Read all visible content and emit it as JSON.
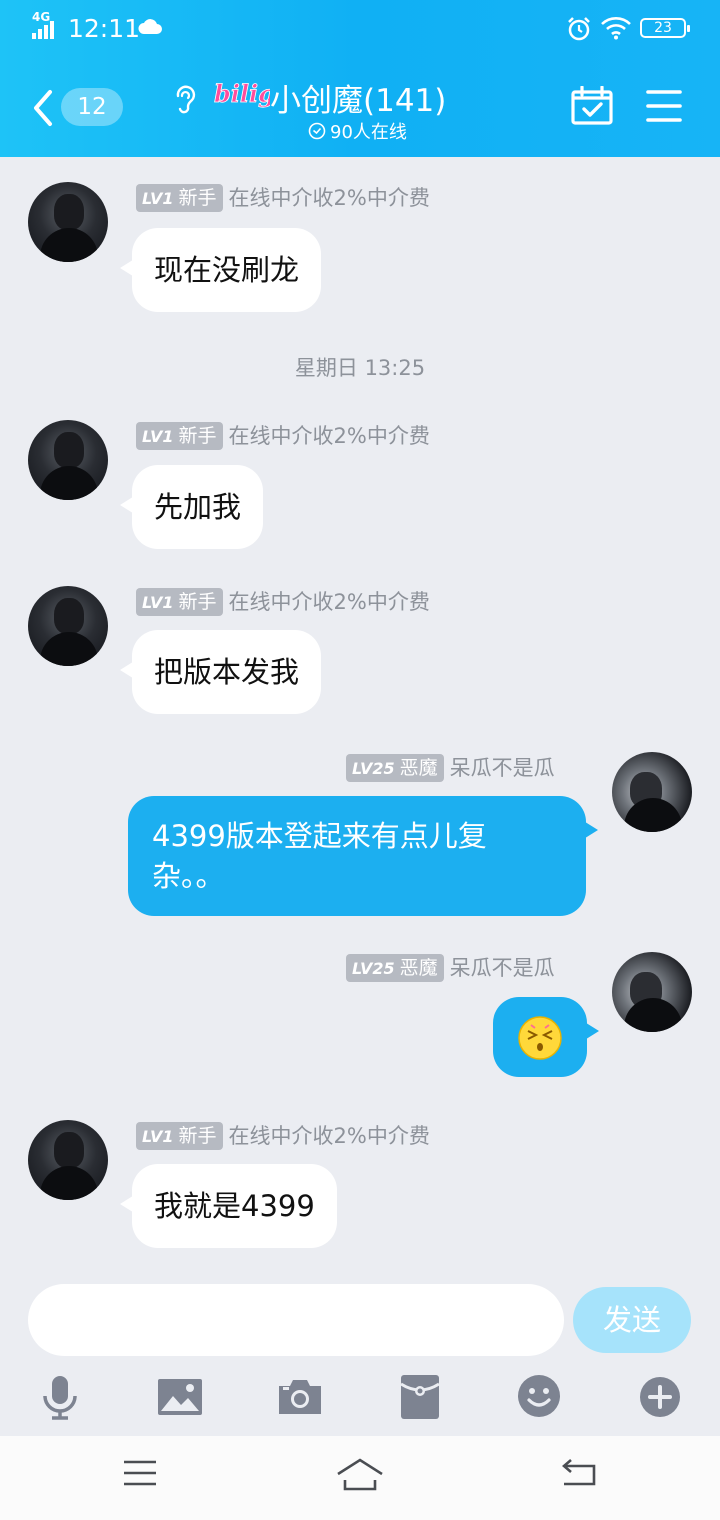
{
  "status_bar": {
    "network": "4G",
    "time": "12:11",
    "battery": "23"
  },
  "header": {
    "unread_count": "12",
    "group_title": "小创魔(141)",
    "online_count": "90人在线",
    "accent_color": "#12b2f5"
  },
  "messages": [
    {
      "side": "left",
      "level": "LV1",
      "rank": "新手",
      "sender": "在线中介收2%中介费",
      "text": "现在没刷龙"
    },
    {
      "side": "left",
      "level": "LV1",
      "rank": "新手",
      "sender": "在线中介收2%中介费",
      "text": "先加我"
    },
    {
      "side": "left",
      "level": "LV1",
      "rank": "新手",
      "sender": "在线中介收2%中介费",
      "text": "把版本发我"
    },
    {
      "side": "right",
      "level": "LV25",
      "rank": "恶魔",
      "sender": "呆瓜不是瓜",
      "text_line1": "4399版本登起来有点儿复",
      "text_line2": "杂。。"
    },
    {
      "side": "right",
      "level": "LV25",
      "rank": "恶魔",
      "sender": "呆瓜不是瓜",
      "emoji": "dizzy-face-emoji"
    },
    {
      "side": "left",
      "level": "LV1",
      "rank": "新手",
      "sender": "在线中介收2%中介费",
      "text": "我就是4399"
    }
  ],
  "timestamp": "星期日 13:25",
  "input": {
    "send_label": "发送"
  },
  "toolbar_icons": [
    "microphone-icon",
    "image-icon",
    "camera-icon",
    "red-packet-icon",
    "emoji-icon",
    "plus-icon"
  ],
  "nav_icons": [
    "recent-apps-icon",
    "home-icon",
    "back-icon"
  ]
}
